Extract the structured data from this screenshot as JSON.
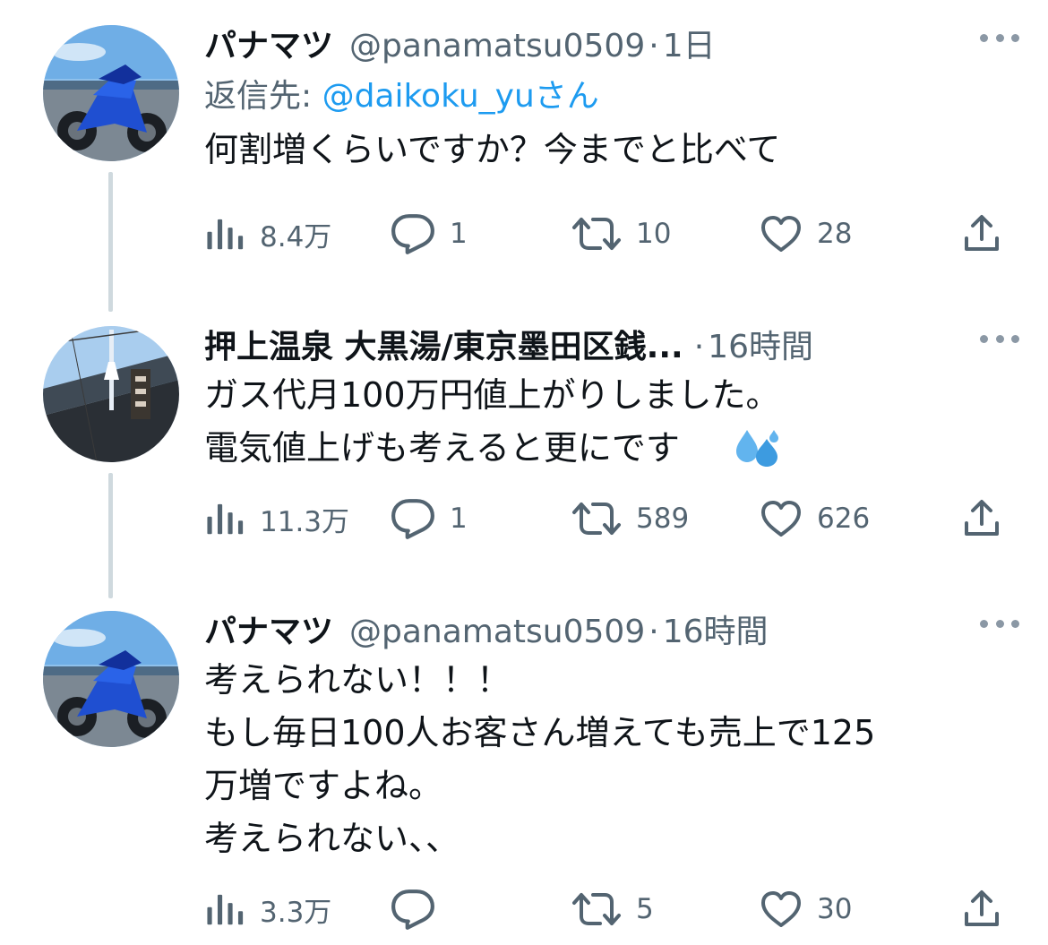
{
  "tweets": [
    {
      "name": "パナマツ",
      "handle": "@panamatsu0509",
      "dot": "·",
      "time": "1日",
      "reply_prefix": "返信先: ",
      "reply_mention": "@daikoku_yu",
      "reply_suffix": "さん",
      "text": "何割増くらいですか？今までと比べて",
      "views": "8.4万",
      "replies": "1",
      "retweets": "10",
      "likes": "28"
    },
    {
      "name": "押上温泉 大黒湯/東京墨田区銭...",
      "dot": "·",
      "time": "16時間",
      "text": "ガス代月100万円値上がりしました。\n電気値上げも考えると更にです",
      "emoji": "sweat-droplets-icon",
      "views": "11.3万",
      "replies": "1",
      "retweets": "589",
      "likes": "626"
    },
    {
      "name": "パナマツ",
      "handle": "@panamatsu0509",
      "dot": "·",
      "time": "16時間",
      "text": "考えられない！！！\nもし毎日100人お客さん増えても売上で125\n万増ですよね。\n考えられない、、",
      "views": "3.3万",
      "replies": "",
      "retweets": "5",
      "likes": "30"
    }
  ],
  "colors": {
    "text": "#0f1419",
    "secondary": "#536471",
    "link": "#1d9bf0",
    "thread_line": "#cfd9de"
  }
}
